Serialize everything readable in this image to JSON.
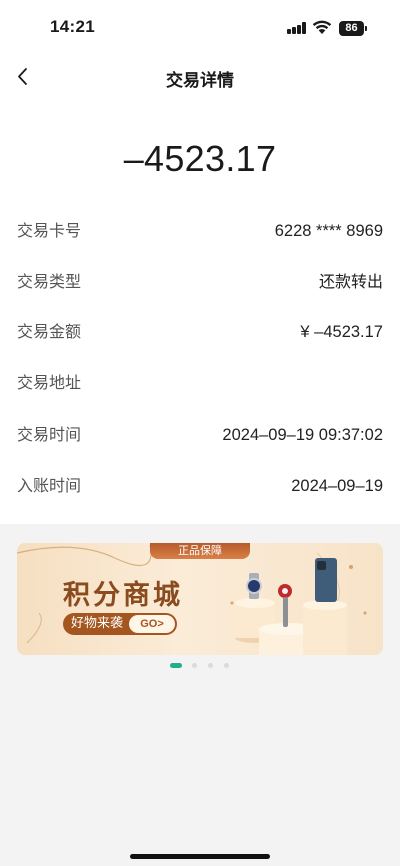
{
  "status_bar": {
    "time": "14:21",
    "battery": "86"
  },
  "nav": {
    "title": "交易详情"
  },
  "amount": "–4523.17",
  "details": [
    {
      "label": "交易卡号",
      "value": "6228 **** 8969"
    },
    {
      "label": "交易类型",
      "value": "还款转出"
    },
    {
      "label": "交易金额",
      "value": "¥ –4523.17"
    },
    {
      "label": "交易地址",
      "value": ""
    },
    {
      "label": "交易时间",
      "value": "2024–09–19 09:37:02"
    },
    {
      "label": "入账时间",
      "value": "2024–09–19"
    }
  ],
  "banner": {
    "tag": "正品保障",
    "title": "积分商城",
    "subtitle": "好物来袭",
    "go_label": "GO>"
  },
  "carousel": {
    "active_index": 0,
    "count": 4
  },
  "colors": {
    "accent": "#1fb08b",
    "banner_brown": "#a5561f"
  }
}
